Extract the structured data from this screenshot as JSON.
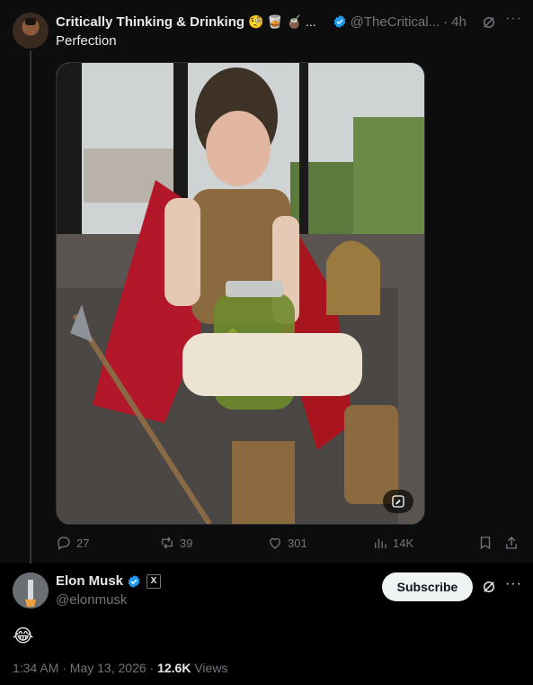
{
  "quoted_post": {
    "author_name": "Critically Thinking & Drinking",
    "author_emojis": "🧐 🥃 🧉 ...",
    "handle": "@TheCritical...",
    "time": "· 4h",
    "text": "Perfection",
    "media_description": "photo",
    "stats": {
      "replies": "27",
      "reposts": "39",
      "likes": "301",
      "views": "14K"
    }
  },
  "reply_post": {
    "author_name": "Elon Musk",
    "x_badge": "X",
    "handle": "@elonmusk",
    "subscribe_label": "Subscribe",
    "text": "😂",
    "time": "1:34 AM · May 13, 2026 · ",
    "views_count": "12.6K",
    "views_label": " Views"
  },
  "colors": {
    "background": "#000000",
    "quoted_background": "#0d0d0d",
    "text": "#e7e9ea",
    "muted": "#71767b",
    "verified_blue": "#1d9bf0"
  }
}
